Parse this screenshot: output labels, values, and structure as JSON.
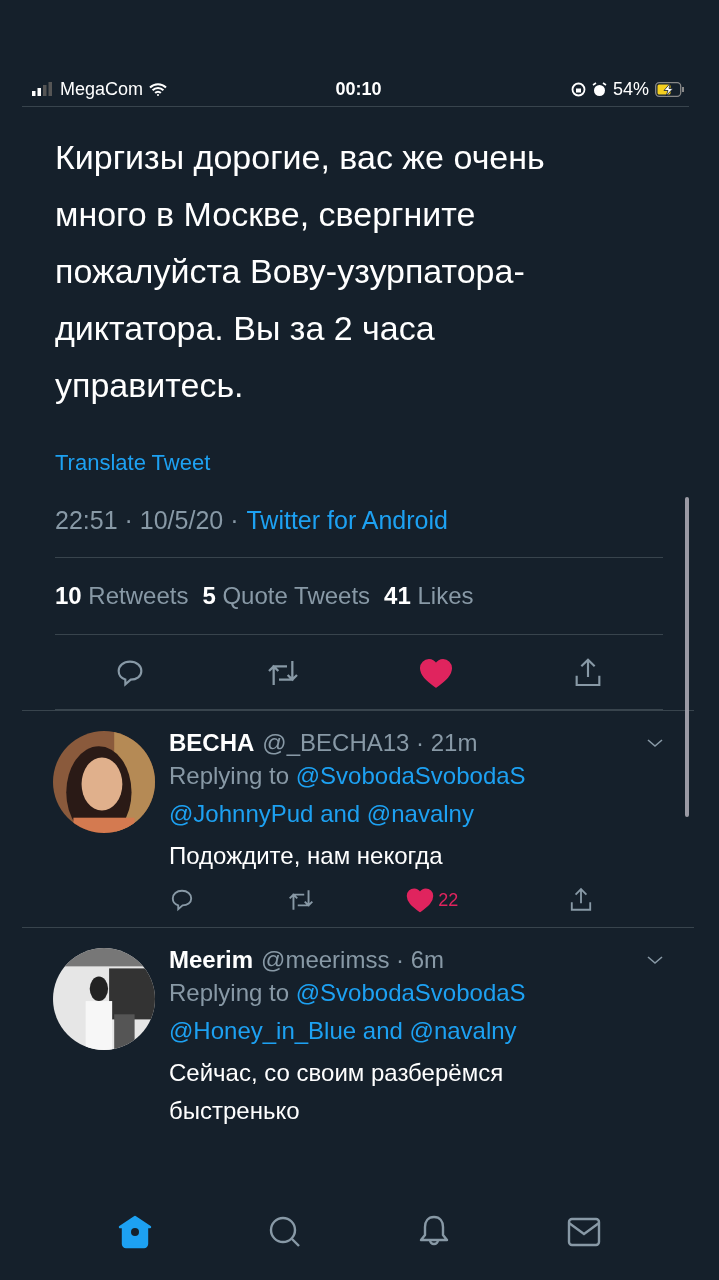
{
  "status_bar": {
    "carrier": "MegaCom",
    "time": "00:10",
    "battery": "54%",
    "charging": true
  },
  "tweet": {
    "text": "Киргизы дорогие, вас же очень много в Москве, свергните пожалуйста Вову-узурпатора-диктатора. Вы за 2 часа управитесь.",
    "translate": "Translate Tweet",
    "meta": "22:51 · 10/5/20 ·",
    "source": "Twitter for Android",
    "stats": [
      {
        "count": "10",
        "label": "Retweets"
      },
      {
        "count": "5",
        "label": "Quote Tweets"
      },
      {
        "count": "41",
        "label": "Likes"
      }
    ],
    "liked": true
  },
  "replies": [
    {
      "name": "ВЕСНА",
      "meta": "@_BECHA13 · 21m",
      "replying": "Replying to",
      "mention": "@SvobodaSvobodaS",
      "mentions_more": "@JohnnyPud and @navalny",
      "text": "Подождите, нам некогда",
      "liked": true,
      "like_count": "22"
    },
    {
      "name": "Meerim",
      "meta": "@meerimss · 6m",
      "replying": "Replying to",
      "mention": "@SvobodaSvobodaS",
      "mentions_more": "@Honey_in_Blue and @navalny",
      "text": "Сейчас, со своим разберёмся быстренько"
    }
  ],
  "nav": [
    {
      "kind": "home",
      "selected": true
    },
    {
      "kind": "search",
      "selected": false
    },
    {
      "kind": "notifications",
      "selected": false
    },
    {
      "kind": "messages",
      "selected": false
    }
  ]
}
